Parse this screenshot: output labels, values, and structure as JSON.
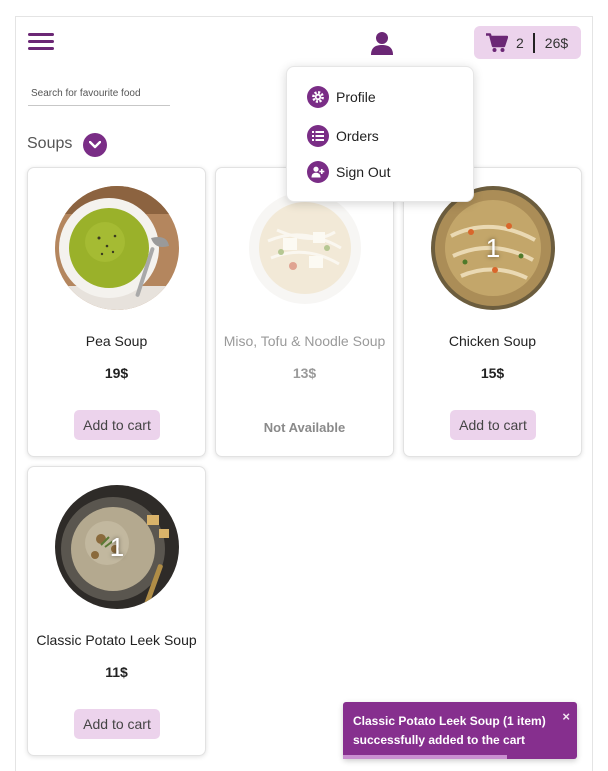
{
  "header": {
    "menu_icon": "hamburger-icon",
    "user_icon": "user-icon",
    "cart": {
      "icon": "cart-icon",
      "count": "2",
      "total": "26$"
    }
  },
  "search": {
    "placeholder": "Search for favourite food",
    "value": ""
  },
  "section": {
    "title": "Soups",
    "toggle_icon": "chevron-down-icon"
  },
  "user_menu": {
    "items": [
      {
        "label": "Profile",
        "icon": "gear-icon"
      },
      {
        "label": "Orders",
        "icon": "list-icon"
      },
      {
        "label": "Sign Out",
        "icon": "user-plus-icon"
      }
    ]
  },
  "products": [
    {
      "name": "Pea Soup",
      "price": "19$",
      "button": "Add to cart",
      "available": true,
      "in_cart": ""
    },
    {
      "name": "Miso, Tofu & Noodle Soup",
      "price": "13$",
      "status": "Not Available",
      "available": false,
      "in_cart": ""
    },
    {
      "name": "Chicken Soup",
      "price": "15$",
      "button": "Add to cart",
      "available": true,
      "in_cart": "1"
    },
    {
      "name": "Classic Potato Leek Soup",
      "price": "11$",
      "button": "Add to cart",
      "available": true,
      "in_cart": "1"
    }
  ],
  "toast": {
    "message": "Classic Potato Leek Soup (1 item) successfully added to the cart",
    "close": "×",
    "progress": 0.7
  },
  "colors": {
    "accent": "#7a2d86",
    "accent_light": "#ecd3ec",
    "toast_bg": "#862f8e"
  }
}
